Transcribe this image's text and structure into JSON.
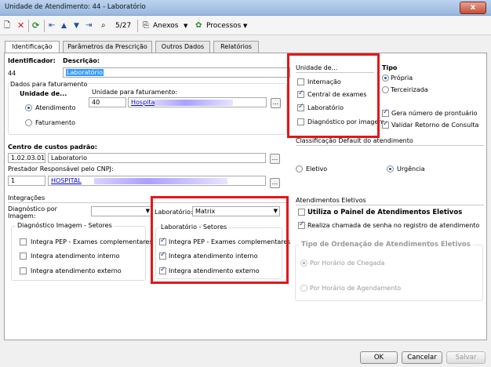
{
  "window": {
    "title": "Unidade de Atendimento: 44 - Laboratório",
    "close": "x"
  },
  "toolbar": {
    "pager": "5/27",
    "anexos": "Anexos",
    "processos": "Processos"
  },
  "tabs": [
    "Identificação",
    "Parâmetros da Prescrição",
    "Outros Dados",
    "Relatórios"
  ],
  "ident": {
    "id_label": "Identificador:",
    "id_value": "44",
    "desc_label": "Descrição:",
    "desc_value": "Laboratório"
  },
  "faturamento": {
    "section": "Dados para faturamento",
    "unidade_label": "Unidade de...",
    "opt_atendimento": "Atendimento",
    "opt_faturamento": "Faturamento",
    "unid_fat_label": "Unidade para faturamento:",
    "unid_fat_code": "40",
    "unid_fat_name": "Hospital",
    "ellipsis": "..."
  },
  "unidade_de": {
    "title": "Unidade de...",
    "internacao": "Internação",
    "central": "Central de exames",
    "laboratorio": "Laboratório",
    "diagnostico": "Diagnóstico por imagem"
  },
  "tipo": {
    "title": "Tipo",
    "propria": "Própria",
    "terceirizada": "Terceirizada",
    "gera_prontuario": "Gera número de prontuário",
    "validar_retorno": "Validar Retorno de Consulta"
  },
  "custos": {
    "label": "Centro de custos padrão:",
    "code": "1.02.03.01",
    "name": "Laboratorio",
    "prestador_label": "Prestador Responsável pelo CNPJ:",
    "prestador_code": "1",
    "prestador_name": "HOSPITAL"
  },
  "classificacao": {
    "title": "Classificação Default do atendimento",
    "eletivo": "Eletivo",
    "urgencia": "Urgência"
  },
  "integracoes": {
    "title": "Integrações",
    "diag_label": "Diagnóstico por Imagem:",
    "lab_label": "Laboratório:",
    "lab_value": "Matrix",
    "diag_setores": "Diagnóstico Imagem - Setores",
    "lab_setores": "Laboratório - Setores",
    "pep": "Integra PEP - Exames complementares",
    "interno": "Integra atendimento interno",
    "externo": "Integra atendimento externo"
  },
  "eletivos": {
    "title": "Atendimentos Eletivos",
    "utiliza": "Utiliza o Painel de Atendimentos Eletivos",
    "realiza": "Realiza chamada de senha no registro de atendimento",
    "ordem_title": "Tipo de Ordenação de Atendimentos Eletivos",
    "por_chegada": "Por Horário de Chegada",
    "por_agendamento": "Por Horário de Agendamento"
  },
  "footer": {
    "ok": "OK",
    "cancelar": "Cancelar",
    "salvar": "Salvar"
  },
  "colors": {
    "highlight": "#e01818",
    "selection": "#3399ff",
    "link": "#0000cc"
  }
}
